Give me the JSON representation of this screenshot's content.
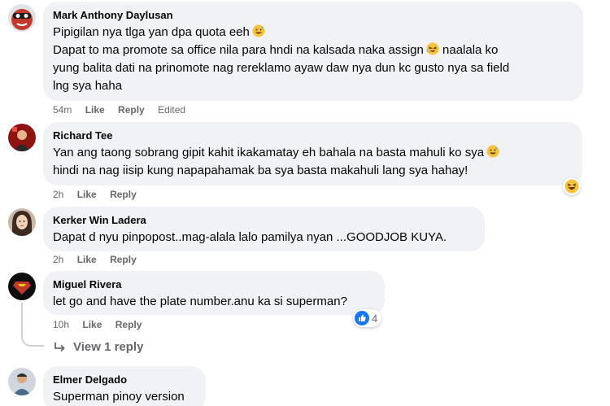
{
  "comments": [
    {
      "author": "Mark Anthony Daylusan",
      "lines": [
        "Pipigilan nya tlga yan dpa quota eeh",
        "Dapat to ma promote sa office nila para hndi na kalsada naka assign",
        "naalala ko",
        "yung balita dati na prinomote nag rereklamo ayaw daw nya dun kc gusto nya sa field",
        "lng sya haha"
      ],
      "time": "54m",
      "like": "Like",
      "reply": "Reply",
      "edited": "Edited"
    },
    {
      "author": "Richard Tee",
      "lines": [
        "Yan ang taong sobrang gipit kahit ikakamatay eh bahala na basta mahuli ko sya",
        "hindi na nag iisip kung napapahamak ba sya basta makahuli lang sya hahay!"
      ],
      "time": "2h",
      "like": "Like",
      "reply": "Reply",
      "reaction": "haha"
    },
    {
      "author": "Kerker Win Ladera",
      "lines": [
        "Dapat d nyu pinpopost..mag-alala lalo pamilya nyan ...GOODJOB KUYA."
      ],
      "time": "2h",
      "like": "Like",
      "reply": "Reply"
    },
    {
      "author": "Miguel Rivera",
      "lines": [
        "let go and have the plate number.anu ka si superman?"
      ],
      "time": "10h",
      "like": "Like",
      "reply": "Reply",
      "reaction": "like",
      "reaction_count": "4"
    },
    {
      "author": "Elmer Delgado",
      "lines": [
        "Superman pinoy version"
      ]
    }
  ],
  "view_replies": "View 1 reply",
  "colors": {
    "bubble": "#f0f2f5",
    "meta": "#65676b",
    "like_blue": "#1877f2",
    "emoji_yellow": "#f7c23c"
  }
}
